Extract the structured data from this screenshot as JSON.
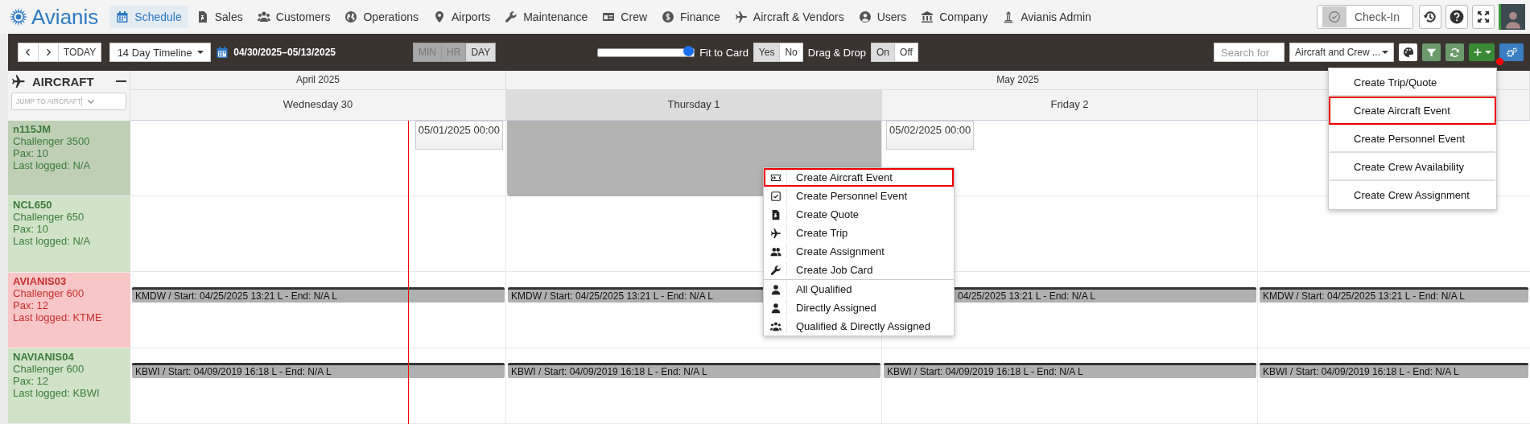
{
  "nav": {
    "logo": "Avianis",
    "items": [
      {
        "label": "Schedule",
        "selected": true
      },
      {
        "label": "Sales",
        "selected": false
      },
      {
        "label": "Customers",
        "selected": false
      },
      {
        "label": "Operations",
        "selected": false
      },
      {
        "label": "Airports",
        "selected": false
      },
      {
        "label": "Maintenance",
        "selected": false
      },
      {
        "label": "Crew",
        "selected": false
      },
      {
        "label": "Finance",
        "selected": false
      },
      {
        "label": "Aircraft & Vendors",
        "selected": false
      },
      {
        "label": "Users",
        "selected": false
      },
      {
        "label": "Company",
        "selected": false
      },
      {
        "label": "Avianis Admin",
        "selected": false
      }
    ],
    "check_in": "Check-In"
  },
  "toolbar": {
    "today": "TODAY",
    "view": "14 Day Timeline",
    "date_range": "04/30/2025–05/13/2025",
    "scales": [
      {
        "label": "MIN",
        "selected": false
      },
      {
        "label": "HR",
        "selected": false
      },
      {
        "label": "DAY",
        "selected": true
      }
    ],
    "zoom": {
      "level": 0.95
    },
    "fit_to_card": {
      "label": "Fit to Card",
      "options": [
        {
          "label": "Yes",
          "selected": true
        },
        {
          "label": "No",
          "selected": false
        }
      ]
    },
    "drag_drop": {
      "label": "Drag & Drop",
      "options": [
        {
          "label": "On",
          "selected": true
        },
        {
          "label": "Off",
          "selected": false
        }
      ]
    },
    "search": {
      "placeholder": "Search for"
    },
    "resource_filter": "Aircraft and Crew ...",
    "settings_alert": true
  },
  "sidebar": {
    "title": "AIRCRAFT",
    "jump": {
      "placeholder": "JUMP TO AIRCRAFT"
    }
  },
  "months": [
    {
      "label": "April 2025",
      "days": [
        {
          "label": "Wednesday 30",
          "highlighted": false
        }
      ]
    },
    {
      "label": "May 2025",
      "days": [
        {
          "label": "Thursday 1",
          "highlighted": true
        },
        {
          "label": "Friday 2",
          "highlighted": false
        },
        {
          "highlighted": false
        }
      ]
    }
  ],
  "aircraft": [
    {
      "tail": "n115JM",
      "model": "Challenger 3500",
      "pax": "Pax: 10",
      "last_logged": "Last logged: N/A",
      "alert": false,
      "selected": true,
      "cells": [
        {
          "events": [
            {
              "kind": "tag",
              "text": "05/01/2025 00:00",
              "end_aligned": true
            }
          ]
        },
        {
          "events": [
            {
              "kind": "block"
            }
          ]
        },
        {
          "events": [
            {
              "kind": "tag",
              "text": "05/02/2025 00:00",
              "end_aligned": false
            }
          ]
        },
        {}
      ]
    },
    {
      "tail": "NCL650",
      "model": "Challenger 650",
      "pax": "Pax: 10",
      "last_logged": "Last logged: N/A",
      "alert": false,
      "selected": false,
      "cells": [
        {},
        {},
        {},
        {}
      ]
    },
    {
      "tail": "AVIANIS03",
      "model": "Challenger 600",
      "pax": "Pax: 12",
      "last_logged": "Last logged: KTME",
      "alert": true,
      "selected": false,
      "cells": [
        {
          "events": [
            {
              "kind": "bar",
              "text": "KMDW / Start: 04/25/2025 13:21 L - End: N/A L",
              "covered": false
            }
          ]
        },
        {
          "events": [
            {
              "kind": "bar",
              "text": "KMDW / Start: 04/25/2025 13:21 L - End: N/A L",
              "covered": false
            }
          ]
        },
        {
          "events": [
            {
              "kind": "bar",
              "text": "04/25/2025 13:21 L - End: N/A L",
              "covered": true
            }
          ]
        },
        {
          "events": [
            {
              "kind": "bar",
              "text": "KMDW / Start: 04/25/2025 13:21 L - End: N/A L",
              "covered": false
            }
          ]
        }
      ]
    },
    {
      "tail": "NAVIANIS04",
      "model": "Challenger 600",
      "pax": "Pax: 12",
      "last_logged": "Last logged: KBWI",
      "alert": false,
      "selected": false,
      "cells": [
        {
          "events": [
            {
              "kind": "bar",
              "text": "KBWI / Start: 04/09/2019 16:18 L - End: N/A L",
              "covered": false
            }
          ]
        },
        {
          "events": [
            {
              "kind": "bar",
              "text": "KBWI / Start: 04/09/2019 16:18 L - End: N/A L",
              "covered": false
            }
          ]
        },
        {
          "events": [
            {
              "kind": "bar",
              "text": "KBWI / Start: 04/09/2019 16:18 L - End: N/A L",
              "covered": false
            }
          ]
        },
        {
          "events": [
            {
              "kind": "bar",
              "text": "KBWI / Start: 04/09/2019 16:18 L - End: N/A L",
              "covered": false
            }
          ]
        }
      ]
    }
  ],
  "context_menu": {
    "groups": [
      [
        {
          "label": "Create Aircraft Event",
          "highlighted": true
        },
        {
          "label": "Create Personnel Event",
          "highlighted": false
        },
        {
          "label": "Create Quote",
          "highlighted": false
        },
        {
          "label": "Create Trip",
          "highlighted": false
        },
        {
          "label": "Create Assignment",
          "highlighted": false
        },
        {
          "label": "Create Job Card",
          "highlighted": false
        }
      ],
      [
        {
          "label": "All Qualified",
          "highlighted": false
        },
        {
          "label": "Directly Assigned",
          "highlighted": false
        },
        {
          "label": "Qualified & Directly Assigned",
          "highlighted": false
        }
      ]
    ]
  },
  "create_menu": {
    "items": [
      {
        "label": "Create Trip/Quote",
        "highlighted": false
      },
      {
        "label": "Create Aircraft Event",
        "highlighted": true
      },
      {
        "label": "Create Personnel Event",
        "highlighted": false
      },
      {
        "label": "Create Crew Availability",
        "highlighted": false
      },
      {
        "label": "Create Crew Assignment",
        "highlighted": false
      }
    ]
  }
}
